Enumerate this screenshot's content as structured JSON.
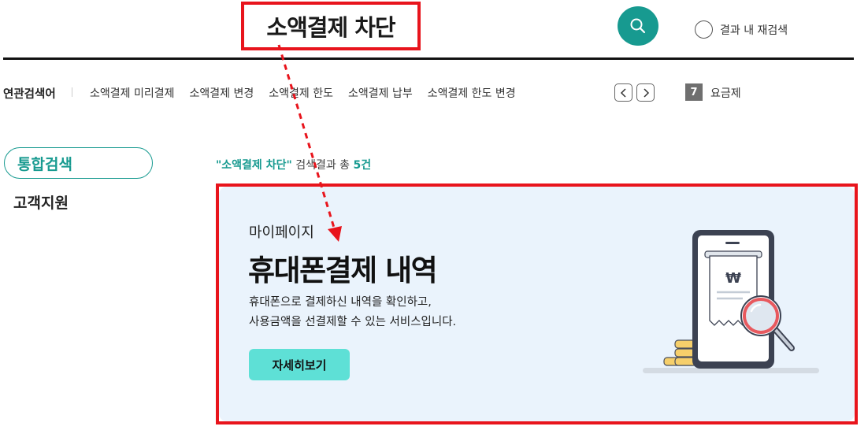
{
  "search": {
    "query": "소액결제 차단",
    "search_button_icon": "search-icon",
    "research_label": "결과 내 재검색"
  },
  "related": {
    "title": "연관검색어",
    "items": [
      {
        "label": "소액결제 미리결제"
      },
      {
        "label": "소액결제 변경"
      },
      {
        "label": "소액결제 한도"
      },
      {
        "label": "소액결제 납부"
      },
      {
        "label": "소액결제 한도 변경"
      }
    ],
    "prev_icon": "chevron-left-icon",
    "next_icon": "chevron-right-icon",
    "rank_number": "7",
    "rank_label": "요금제"
  },
  "nav": {
    "active_tab": "통합검색",
    "tabs": [
      {
        "label": "고객지원"
      }
    ]
  },
  "summary": {
    "query_quoted": "\"소액결제 차단\"",
    "text": " 검색결과 총 ",
    "count": "5건"
  },
  "result": {
    "category": "마이페이지",
    "title": "휴대폰결제 내역",
    "desc_line1": "휴대폰으로 결제하신 내역을 확인하고,",
    "desc_line2": "사용금액을 선결제할 수 있는 서비스입니다.",
    "button_label": "자세히보기",
    "illustration_icon": "phone-receipt-magnifier-illustration",
    "illustration_symbol": "₩"
  },
  "colors": {
    "accent": "#179a90",
    "highlight_box": "#e8141c",
    "card_bg": "#eaf3fc",
    "button_bg": "#5ee0d6"
  }
}
